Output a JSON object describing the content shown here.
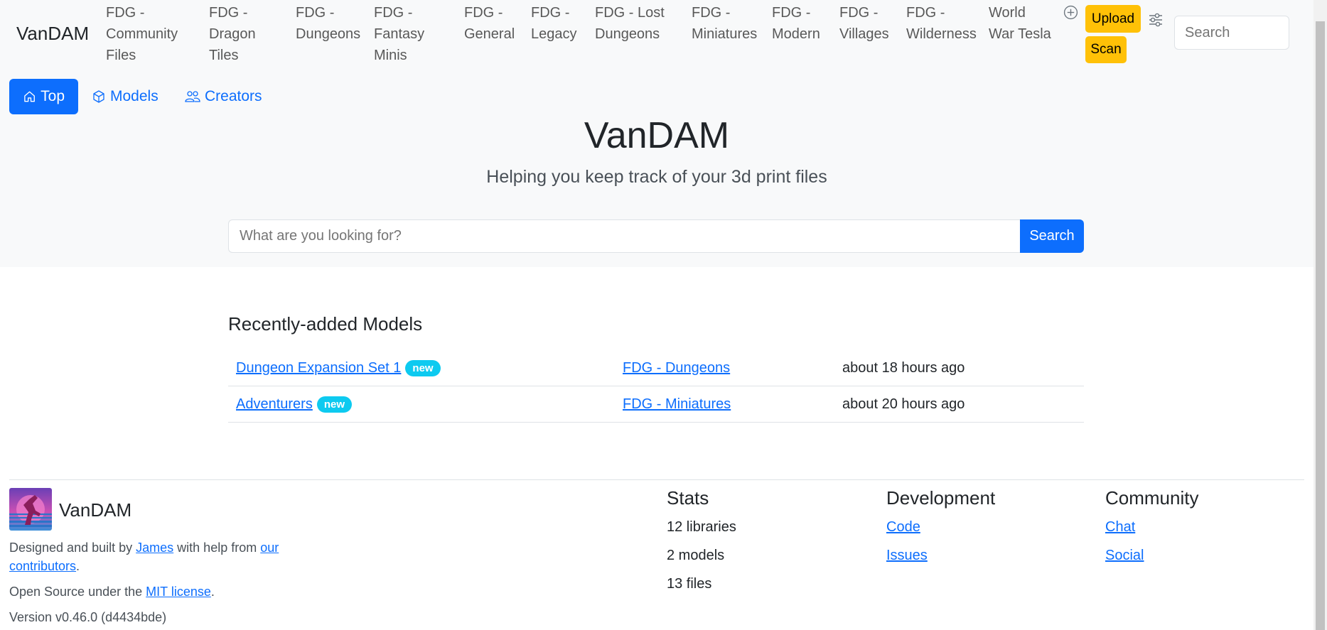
{
  "navbar": {
    "brand": "VanDAM",
    "links": [
      {
        "line1": "FDG -",
        "line2": "Community",
        "line3": "Files"
      },
      {
        "line1": "FDG -",
        "line2": "Dragon",
        "line3": "Tiles"
      },
      {
        "line1": "FDG -",
        "line2": "Dungeons"
      },
      {
        "line1": "FDG -",
        "line2": "Fantasy",
        "line3": "Minis"
      },
      {
        "line1": "FDG -",
        "line2": "General"
      },
      {
        "line1": "FDG -",
        "line2": "Legacy"
      },
      {
        "line1": "FDG - Lost",
        "line2": "Dungeons"
      },
      {
        "line1": "FDG -",
        "line2": "Miniatures"
      },
      {
        "line1": "FDG -",
        "line2": "Modern"
      },
      {
        "line1": "FDG -",
        "line2": "Villages"
      },
      {
        "line1": "FDG -",
        "line2": "Wilderness"
      },
      {
        "line1": "World",
        "line2": "War Tesla"
      }
    ],
    "add_icon": "plus-circle-icon",
    "upload_label": "Upload",
    "scan_label": "Scan",
    "settings_icon": "sliders-icon",
    "search_placeholder": "Search"
  },
  "tabs": [
    {
      "label": "Top",
      "icon": "house-icon",
      "active": true
    },
    {
      "label": "Models",
      "icon": "box-icon",
      "active": false
    },
    {
      "label": "Creators",
      "icon": "people-icon",
      "active": false
    }
  ],
  "hero": {
    "title": "VanDAM",
    "subtitle": "Helping you keep track of your 3d print files",
    "search_placeholder": "What are you looking for?",
    "search_button": "Search"
  },
  "recent": {
    "title": "Recently-added Models",
    "rows": [
      {
        "name": "Dungeon Expansion Set 1",
        "badge": "new",
        "library": "FDG - Dungeons",
        "time": "about 18 hours ago"
      },
      {
        "name": "Adventurers",
        "badge": "new",
        "library": "FDG - Miniatures",
        "time": "about 20 hours ago"
      }
    ]
  },
  "footer": {
    "brand": "VanDAM",
    "designed_prefix": "Designed and built by",
    "author_link": "James",
    "designed_mid": "with help from",
    "contrib_link_1": "our",
    "contrib_link_2": "contributors",
    "designed_suffix": ".",
    "license_prefix": "Open Source under the",
    "license_link": "MIT license",
    "license_suffix": ".",
    "version": "Version v0.46.0 (d4434bde)",
    "stats": {
      "heading": "Stats",
      "items": [
        "12 libraries",
        "2 models",
        "13 files"
      ]
    },
    "development": {
      "heading": "Development",
      "links": [
        "Code",
        "Issues"
      ]
    },
    "community": {
      "heading": "Community",
      "links": [
        "Chat",
        "Social"
      ]
    }
  },
  "colors": {
    "primary": "#0d6efd",
    "warning": "#ffc107",
    "info": "#0dcaf0",
    "light": "#f8f9fa"
  }
}
